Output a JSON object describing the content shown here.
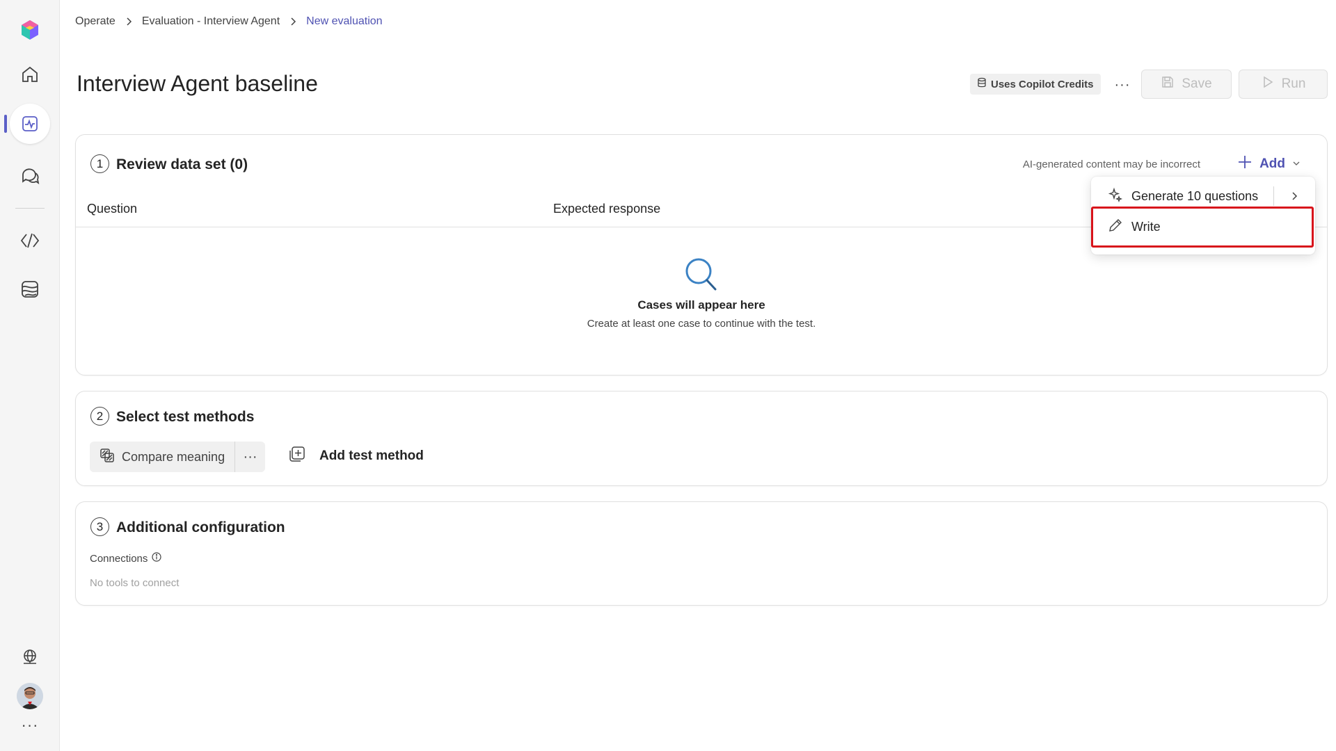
{
  "nav": {
    "items": [
      {
        "icon": "home-icon"
      },
      {
        "icon": "evaluation-icon",
        "active": true
      },
      {
        "icon": "chat-icon"
      },
      {
        "icon": "code-icon"
      },
      {
        "icon": "agent-flow-icon"
      }
    ],
    "bottom": [
      "globe-icon",
      "avatar",
      "more-icon"
    ],
    "accent": "#5b5fc7"
  },
  "breadcrumb": {
    "items": [
      "Operate",
      "Evaluation - Interview Agent",
      "New evaluation"
    ]
  },
  "page": {
    "title": "Interview Agent baseline"
  },
  "header_actions": {
    "credits": "Uses Copilot Credits",
    "more": "···",
    "save": "Save",
    "run": "Run"
  },
  "section1": {
    "number": "1",
    "title": "Review data set (0)",
    "ai_note": "AI-generated content may be incorrect",
    "add_label": "Add",
    "columns": {
      "question": "Question",
      "expected": "Expected response"
    },
    "empty_title": "Cases will appear here",
    "empty_subtitle": "Create at least one case to continue with the test."
  },
  "section2": {
    "number": "2",
    "title": "Select test methods",
    "method_label": "Compare meaning",
    "method_more": "···",
    "add_method": "Add test method"
  },
  "section3": {
    "number": "3",
    "title": "Additional configuration",
    "connections_label": "Connections",
    "connections_empty": "No tools to connect"
  },
  "dropdown": {
    "generate_label": "Generate 10 questions",
    "write_label": "Write",
    "highlight_color": "#d8131b"
  }
}
